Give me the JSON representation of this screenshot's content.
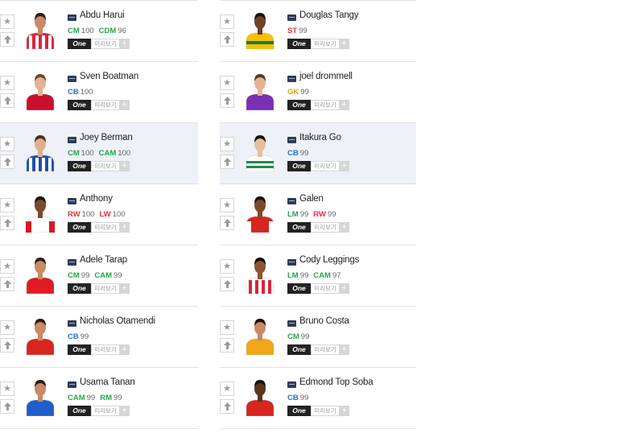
{
  "labels": {
    "one": "One",
    "preview": "미리보기",
    "plus": "+",
    "star": "★"
  },
  "colors": {
    "green": "#26a64a",
    "blue": "#2a6fd6",
    "red": "#e0333c",
    "gold": "#e0a400",
    "highlight": "#eef1f7"
  },
  "left_players": [
    {
      "name": "Abdu Harui",
      "positions": [
        {
          "pos": "CM",
          "ovr": "100",
          "color": "green"
        },
        {
          "pos": "CDM",
          "ovr": "96",
          "color": "green"
        }
      ],
      "highlight": false,
      "skin": "#c98a64",
      "hair": "#2b1d14",
      "shirt": "#d7263d",
      "stripe": "#ffffff",
      "pattern": "vstripes"
    },
    {
      "name": "Sven Boatman",
      "positions": [
        {
          "pos": "CB",
          "ovr": "100",
          "color": "blue"
        }
      ],
      "highlight": false,
      "skin": "#e2b394",
      "hair": "#6b4a2f",
      "shirt": "#c8102e",
      "stripe": "#1e2a6b",
      "pattern": "solid"
    },
    {
      "name": "Joey Berman",
      "positions": [
        {
          "pos": "CM",
          "ovr": "100",
          "color": "green"
        },
        {
          "pos": "CAM",
          "ovr": "100",
          "color": "green"
        }
      ],
      "highlight": true,
      "skin": "#e0b08e",
      "hair": "#4a2f1c",
      "shirt": "#1f4fa8",
      "stripe": "#ffffff",
      "pattern": "vstripes"
    },
    {
      "name": "Anthony",
      "positions": [
        {
          "pos": "RW",
          "ovr": "100",
          "color": "red"
        },
        {
          "pos": "LW",
          "ovr": "100",
          "color": "red"
        }
      ],
      "highlight": false,
      "skin": "#7a4b2e",
      "hair": "#1a120c",
      "shirt": "#ffffff",
      "stripe": "#d71920",
      "pattern": "sleeves"
    },
    {
      "name": "Adele Tarap",
      "positions": [
        {
          "pos": "CM",
          "ovr": "99",
          "color": "green"
        },
        {
          "pos": "CAM",
          "ovr": "99",
          "color": "green"
        }
      ],
      "highlight": false,
      "skin": "#c98a64",
      "hair": "#2b1d14",
      "shirt": "#e01b24",
      "stripe": "#e01b24",
      "pattern": "solid"
    },
    {
      "name": "Nicholas Otamendi",
      "positions": [
        {
          "pos": "CB",
          "ovr": "99",
          "color": "blue"
        }
      ],
      "highlight": false,
      "skin": "#c98a64",
      "hair": "#2b1d14",
      "shirt": "#d7261e",
      "stripe": "#d7261e",
      "pattern": "solid"
    },
    {
      "name": "Usama Tanan",
      "positions": [
        {
          "pos": "CAM",
          "ovr": "99",
          "color": "green"
        },
        {
          "pos": "RM",
          "ovr": "99",
          "color": "green"
        }
      ],
      "highlight": false,
      "skin": "#c98a64",
      "hair": "#2b1d14",
      "shirt": "#1f5fc9",
      "stripe": "#1f5fc9",
      "pattern": "solid"
    }
  ],
  "right_players": [
    {
      "name": "Douglas Tangy",
      "positions": [
        {
          "pos": "ST",
          "ovr": "99",
          "color": "red"
        }
      ],
      "highlight": false,
      "skin": "#6e4128",
      "hair": "#1a120c",
      "shirt": "#f2c200",
      "stripe": "#1f7a3a",
      "pattern": "hband"
    },
    {
      "name": "joel drommell",
      "positions": [
        {
          "pos": "GK",
          "ovr": "99",
          "color": "gold"
        }
      ],
      "highlight": false,
      "skin": "#e2b394",
      "hair": "#5a3a22",
      "shirt": "#7b2fb5",
      "stripe": "#7b2fb5",
      "pattern": "solid"
    },
    {
      "name": "Itakura Go",
      "positions": [
        {
          "pos": "CB",
          "ovr": "99",
          "color": "blue"
        }
      ],
      "highlight": true,
      "skin": "#e5c09b",
      "hair": "#1a120c",
      "shirt": "#ffffff",
      "stripe": "#1e8a4a",
      "pattern": "hstripes"
    },
    {
      "name": "Galen",
      "positions": [
        {
          "pos": "LM",
          "ovr": "99",
          "color": "green"
        },
        {
          "pos": "RW",
          "ovr": "99",
          "color": "red"
        }
      ],
      "highlight": false,
      "skin": "#7a4b2e",
      "hair": "#1a120c",
      "shirt": "#d7261e",
      "stripe": "#ffffff",
      "pattern": "sleeves"
    },
    {
      "name": "Cody Leggings",
      "positions": [
        {
          "pos": "LM",
          "ovr": "99",
          "color": "green"
        },
        {
          "pos": "CAM",
          "ovr": "97",
          "color": "green"
        }
      ],
      "highlight": false,
      "skin": "#8a5534",
      "hair": "#1a120c",
      "shirt": "#ffffff",
      "stripe": "#d7263d",
      "pattern": "vstripes"
    },
    {
      "name": "Bruno Costa",
      "positions": [
        {
          "pos": "CM",
          "ovr": "99",
          "color": "green"
        }
      ],
      "highlight": false,
      "skin": "#c98a64",
      "hair": "#1a120c",
      "shirt": "#f0a818",
      "stripe": "#f0a818",
      "pattern": "solid"
    },
    {
      "name": "Edmond Top Soba",
      "positions": [
        {
          "pos": "CB",
          "ovr": "99",
          "color": "blue"
        }
      ],
      "highlight": false,
      "skin": "#5a3520",
      "hair": "#1a120c",
      "shirt": "#d7261e",
      "stripe": "#f2c200",
      "pattern": "solid"
    }
  ]
}
